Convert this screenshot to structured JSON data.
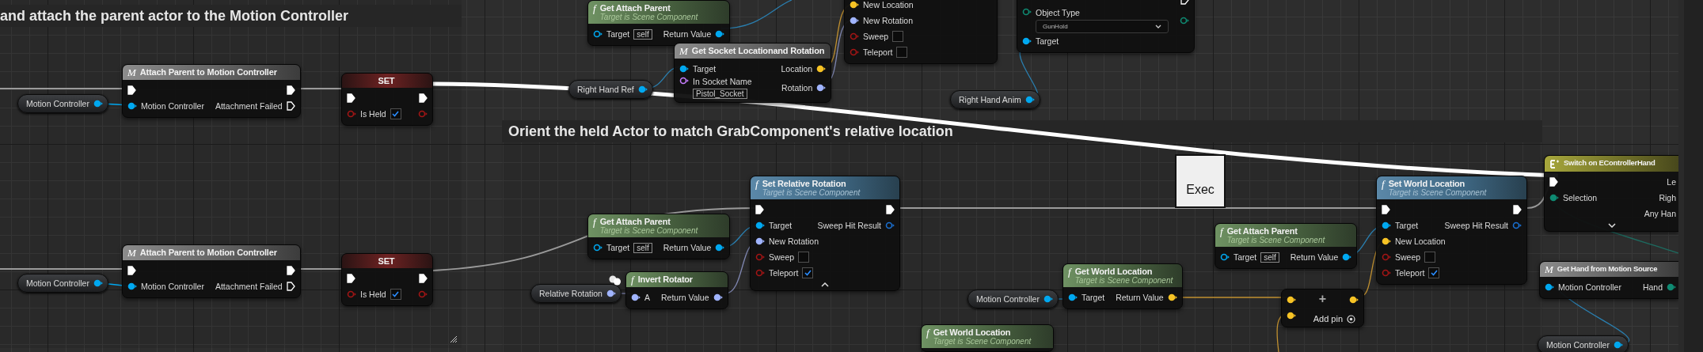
{
  "comments": [
    {
      "title": "and attach the parent actor to the Motion Controller"
    },
    {
      "title": "Orient the held Actor to match GrabComponent's relative location"
    }
  ],
  "nodes": [
    {
      "kind": "variable",
      "title": "Motion Controller",
      "pin": {
        "kind": "object",
        "connected": true
      }
    },
    {
      "kind": "macro",
      "icon": "M",
      "title": "Attach Parent to Motion Controller",
      "rows": [
        {
          "in": {
            "kind": "exec",
            "connected": true
          },
          "out": {
            "kind": "exec",
            "connected": true
          }
        },
        {
          "in": {
            "label": "Motion Controller",
            "kind": "object",
            "connected": true
          },
          "out": {
            "label": "Attachment Failed",
            "kind": "exec",
            "connected": false
          }
        }
      ]
    },
    {
      "kind": "set",
      "title": "SET",
      "rows": [
        {
          "in": {
            "kind": "exec",
            "connected": true
          },
          "out": {
            "kind": "exec",
            "connected": true
          }
        },
        {
          "in": {
            "label": "Is Held",
            "kind": "bool",
            "connected": false,
            "checked": true
          },
          "out": {
            "kind": "bool",
            "connected": false
          }
        }
      ]
    },
    {
      "kind": "pure",
      "icon": "f",
      "title": "Get Attach Parent",
      "subtitle": "Target is Scene Component",
      "rows": [
        {
          "in": {
            "label": "Target",
            "kind": "object",
            "connected": false,
            "value": "self"
          },
          "out": {
            "label": "Return Value",
            "kind": "object",
            "connected": true
          }
        }
      ]
    },
    {
      "kind": "headless",
      "rows": [
        {
          "in": {
            "label": "New Location",
            "kind": "vector",
            "connected": true
          }
        },
        {
          "in": {
            "label": "New Rotation",
            "kind": "rotator",
            "connected": true
          }
        },
        {
          "in": {
            "label": "Sweep",
            "kind": "bool",
            "connected": false,
            "checked": false
          }
        },
        {
          "in": {
            "label": "Teleport",
            "kind": "bool",
            "connected": false,
            "checked": false
          }
        }
      ]
    },
    {
      "kind": "headless",
      "rows": [
        {
          "out": {
            "kind": "exec",
            "connected": false
          }
        },
        {
          "in": {
            "label": "Object Type",
            "kind": "enum",
            "connected": false,
            "dropdown": "GunHold"
          },
          "out": {
            "kind": "enum",
            "connected": false
          }
        },
        {
          "in": {
            "label": "Target",
            "kind": "object",
            "connected": true
          }
        }
      ]
    },
    {
      "kind": "macro",
      "icon": "M",
      "title": "Get Socket Locationand Rotation",
      "rows": [
        {
          "in": {
            "label": "Target",
            "kind": "object",
            "connected": true
          },
          "out": {
            "label": "Location",
            "kind": "vector",
            "connected": true
          }
        },
        {
          "in": {
            "label": "In Socket Name",
            "kind": "name",
            "connected": false,
            "value": "Pistol_Socket"
          },
          "out": {
            "label": "Rotation",
            "kind": "rotator",
            "connected": true
          }
        }
      ]
    },
    {
      "kind": "variable",
      "title": "Right Hand Ref",
      "pin": {
        "kind": "object",
        "connected": true
      }
    },
    {
      "kind": "variable",
      "title": "Right Hand Anim",
      "pin": {
        "kind": "object",
        "connected": true
      }
    },
    {
      "kind": "variable",
      "title": "Motion Controller",
      "pin": {
        "kind": "object",
        "connected": true
      }
    },
    {
      "kind": "macro",
      "icon": "M",
      "title": "Attach Parent to Motion Controller",
      "rows": [
        {
          "in": {
            "kind": "exec",
            "connected": true
          },
          "out": {
            "kind": "exec",
            "connected": true
          }
        },
        {
          "in": {
            "label": "Motion Controller",
            "kind": "object",
            "connected": true
          },
          "out": {
            "label": "Attachment Failed",
            "kind": "exec",
            "connected": false
          }
        }
      ]
    },
    {
      "kind": "set",
      "title": "SET",
      "rows": [
        {
          "in": {
            "kind": "exec",
            "connected": true
          },
          "out": {
            "kind": "exec",
            "connected": true
          }
        },
        {
          "in": {
            "label": "Is Held",
            "kind": "bool",
            "connected": false,
            "checked": true
          },
          "out": {
            "kind": "bool",
            "connected": false
          }
        }
      ]
    },
    {
      "kind": "variable",
      "title": "Relative Rotation",
      "pin": {
        "kind": "rotator",
        "connected": true
      },
      "comment_bubble": true
    },
    {
      "kind": "pure",
      "icon": "f",
      "title": "Get Attach Parent",
      "subtitle": "Target is Scene Component",
      "rows": [
        {
          "in": {
            "label": "Target",
            "kind": "object",
            "connected": false,
            "value": "self"
          },
          "out": {
            "label": "Return Value",
            "kind": "object",
            "connected": true
          }
        }
      ]
    },
    {
      "kind": "pure",
      "icon": "f",
      "title": "Invert Rotator",
      "rows": [
        {
          "in": {
            "label": "A",
            "kind": "rotator",
            "connected": true
          },
          "out": {
            "label": "Return Value",
            "kind": "rotator",
            "connected": true
          }
        }
      ]
    },
    {
      "kind": "impure",
      "icon": "f",
      "title": "Set Relative Rotation",
      "subtitle": "Target is Scene Component",
      "expanded": true,
      "rows": [
        {
          "in": {
            "kind": "exec",
            "connected": true
          },
          "out": {
            "kind": "exec",
            "connected": true
          }
        },
        {
          "in": {
            "label": "Target",
            "kind": "object",
            "connected": true
          },
          "out": {
            "label": "Sweep Hit Result",
            "kind": "struct",
            "connected": false
          }
        },
        {
          "in": {
            "label": "New Rotation",
            "kind": "rotator",
            "connected": true
          }
        },
        {
          "in": {
            "label": "Sweep",
            "kind": "bool",
            "connected": false,
            "checked": false
          }
        },
        {
          "in": {
            "label": "Teleport",
            "kind": "bool",
            "connected": false,
            "checked": true
          }
        }
      ]
    },
    {
      "kind": "tooltip",
      "title": "Exec"
    },
    {
      "kind": "variable",
      "title": "Motion Controller",
      "pin": {
        "kind": "object",
        "connected": true
      }
    },
    {
      "kind": "pure",
      "icon": "f",
      "title": "Get World Location",
      "subtitle": "Target is Scene Component",
      "rows": [
        {
          "in": {
            "label": "Target",
            "kind": "object",
            "connected": true
          },
          "out": {
            "label": "Return Value",
            "kind": "vector",
            "connected": true
          }
        }
      ]
    },
    {
      "kind": "pure",
      "icon": "f",
      "title": "Get World Location",
      "subtitle": "Target is Scene Component"
    },
    {
      "kind": "pure",
      "icon": "f",
      "title": "Get Attach Parent",
      "subtitle": "Target is Scene Component",
      "rows": [
        {
          "in": {
            "label": "Target",
            "kind": "object",
            "connected": false,
            "value": "self"
          },
          "out": {
            "label": "Return Value",
            "kind": "object",
            "connected": true
          }
        }
      ]
    },
    {
      "kind": "math",
      "icon": "+",
      "add_pin": "Add pin",
      "rows": [
        {
          "in": {
            "kind": "vector",
            "connected": true
          },
          "out": {
            "kind": "vector",
            "connected": true
          }
        },
        {
          "in": {
            "kind": "vector",
            "connected": true
          }
        }
      ]
    },
    {
      "kind": "impure",
      "icon": "f",
      "title": "Set World Location",
      "subtitle": "Target is Scene Component",
      "rows": [
        {
          "in": {
            "kind": "exec",
            "connected": true
          },
          "out": {
            "kind": "exec",
            "connected": true
          }
        },
        {
          "in": {
            "label": "Target",
            "kind": "object",
            "connected": true
          },
          "out": {
            "label": "Sweep Hit Result",
            "kind": "struct",
            "connected": false
          }
        },
        {
          "in": {
            "label": "New Location",
            "kind": "vector",
            "connected": true
          }
        },
        {
          "in": {
            "label": "Sweep",
            "kind": "bool",
            "connected": false,
            "checked": false
          }
        },
        {
          "in": {
            "label": "Teleport",
            "kind": "bool",
            "connected": false,
            "checked": true
          }
        }
      ]
    },
    {
      "kind": "switch",
      "title": "Switch on EControllerHand",
      "expanded": false,
      "rows": [
        {
          "in": {
            "kind": "exec",
            "connected": true
          },
          "out": {
            "label": "Le"
          }
        },
        {
          "in": {
            "label": "Selection",
            "kind": "enum",
            "connected": true
          },
          "out": {
            "label": "Righ"
          }
        },
        {
          "out": {
            "label": "Any Han"
          }
        }
      ]
    },
    {
      "kind": "macro",
      "icon": "M",
      "title": "Get Hand from Motion Source",
      "rows": [
        {
          "in": {
            "label": "Motion Controller",
            "kind": "object",
            "connected": true
          },
          "out": {
            "label": "Hand",
            "kind": "enum",
            "connected": true
          }
        }
      ]
    },
    {
      "kind": "variable",
      "title": "Motion Controller",
      "pin": {
        "kind": "object",
        "connected": true
      }
    }
  ]
}
